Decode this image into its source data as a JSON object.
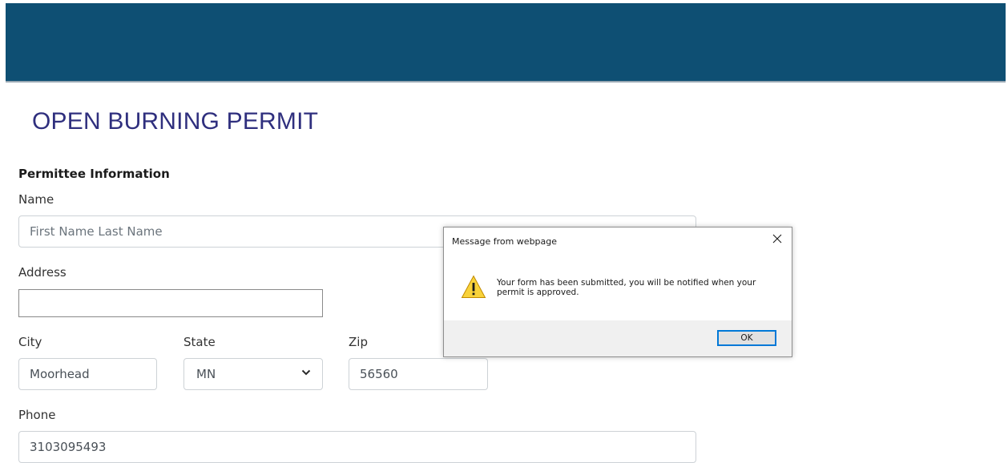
{
  "colors": {
    "header_bar": "#0e4f73",
    "title": "#2f2f7e",
    "dialog_accent": "#0078d7"
  },
  "page": {
    "title": "OPEN BURNING PERMIT",
    "section_heading": "Permittee Information"
  },
  "form": {
    "name_label": "Name",
    "name_placeholder": "First Name Last Name",
    "address_label": "Address",
    "address_value": "",
    "city_label": "City",
    "city_value": "Moorhead",
    "state_label": "State",
    "state_value": "MN",
    "zip_label": "Zip",
    "zip_value": "56560",
    "phone_label": "Phone",
    "phone_value": "3103095493"
  },
  "dialog": {
    "title": "Message from webpage",
    "message": "Your form has been submitted, you will be notified when your permit is approved.",
    "ok_label": "OK",
    "icon": "warning-icon",
    "close_icon": "close-icon"
  }
}
